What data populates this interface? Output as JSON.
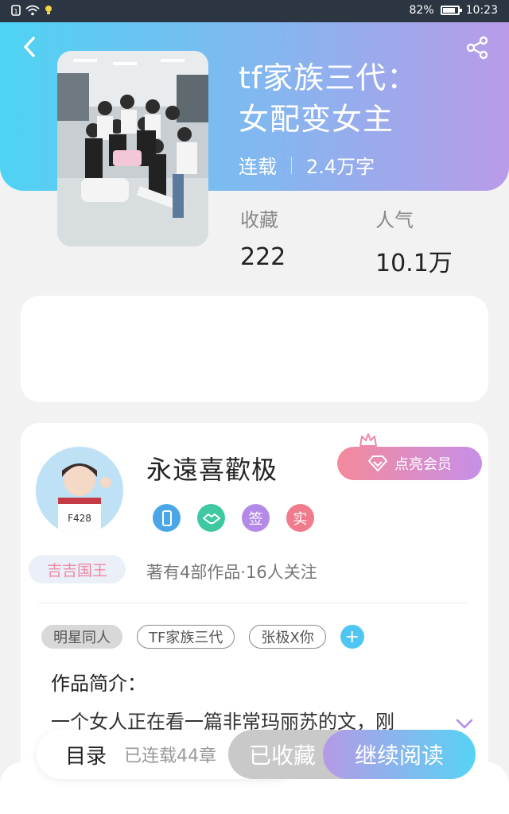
{
  "status_bar": {
    "battery": "82%",
    "battery_level": 0.82,
    "time": "10:23",
    "icons": [
      "sim-icon",
      "wifi-icon",
      "bulb-icon"
    ]
  },
  "header": {
    "title_line1": "tf家族三代：",
    "title_line2": "女配变女主",
    "status": "连载",
    "word_count": "2.4万字",
    "icons": [
      "back-icon",
      "share-icon"
    ],
    "gradient": [
      "#4ed3f3",
      "#b99be9"
    ]
  },
  "stats": {
    "favorites_label": "收藏",
    "favorites_value": "222",
    "popularity_label": "人气",
    "popularity_value": "10.1万"
  },
  "author": {
    "name": "永遠喜歡极",
    "member_button": "点亮会员",
    "badges": [
      {
        "icon": "phone-badge-icon",
        "text": "",
        "color": "#4aa6e6"
      },
      {
        "icon": "handshake-badge-icon",
        "text": "",
        "color": "#3fc9a3"
      },
      {
        "icon": "sign-badge",
        "text": "签",
        "color": "#b48ae8"
      },
      {
        "icon": "real-badge",
        "text": "实",
        "color": "#f07b8c"
      }
    ],
    "level_tag": "吉吉国王",
    "works_info": "著有4部作品·16人关注"
  },
  "tags": [
    "明星同人",
    "TF家族三代",
    "张极X你"
  ],
  "intro": {
    "title": "作品简介：",
    "text": "一个女人正在看一篇非常玛丽苏的文，刚"
  },
  "bottom": {
    "toc_label": "目录",
    "chapters": "已连载44章",
    "collected_label": "已收藏",
    "continue_label": "继续阅读"
  }
}
